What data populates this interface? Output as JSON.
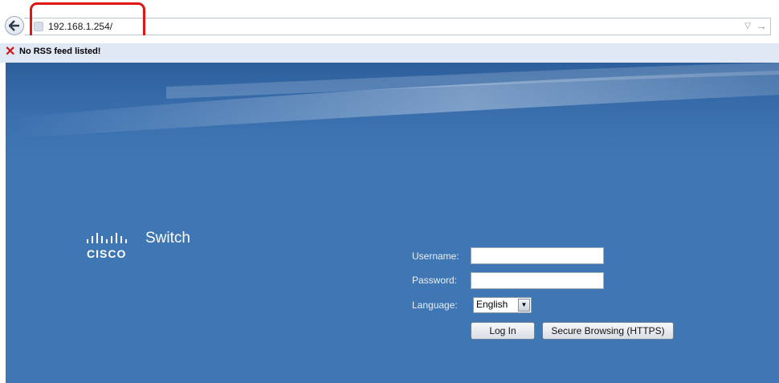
{
  "browser": {
    "url": "192.168.1.254/",
    "rss_message": "No RSS feed listed!",
    "icons": [
      "back-arrow-icon",
      "page-icon",
      "dropdown-arrow-icon",
      "forward-arrow-icon",
      "close-x-icon"
    ]
  },
  "brand": {
    "logo_text": "CISCO",
    "product": "Switch"
  },
  "login": {
    "username_label": "Username:",
    "username_value": "",
    "password_label": "Password:",
    "password_value": "",
    "language_label": "Language:",
    "language_value": "English",
    "login_button": "Log In",
    "secure_button": "Secure Browsing (HTTPS)"
  },
  "colors": {
    "page_bg": "#3f77b4",
    "highlight": "#e01515"
  }
}
